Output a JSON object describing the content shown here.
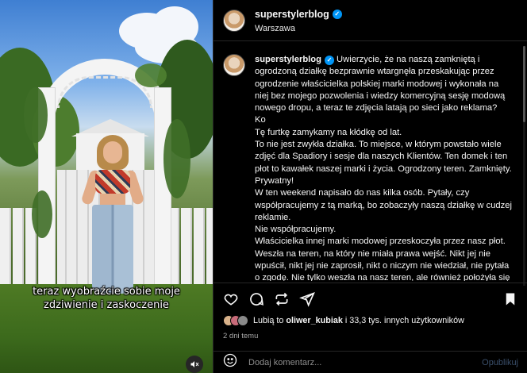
{
  "post": {
    "username": "superstylerblog",
    "location": "Warszawa",
    "caption_lines": [
      "Uwierzycie, że na naszą zamkniętą i",
      "ogrodzoną działkę bezprawnie wtargnęła przeskakując przez",
      "ogrodzenie właścicielka polskiej marki modowej i wykonała na",
      "niej bez mojego pozwolenia i wiedzy komercyjną sesję modową",
      "nowego dropu, a teraz te zdjęcia latają po sieci jako reklama?",
      "Ko",
      "Tę furtkę zamykamy na kłódkę od lat.",
      "To nie jest zwykła działka. To miejsce, w którym powstało wiele",
      "zdjęć dla Spadiory i sesje dla naszych Klientów. Ten domek i ten",
      "płot to kawałek naszej marki i życia. Ogrodzony teren. Zamknięty.",
      "Prywatny!",
      "W ten weekend napisało do nas kilka osób. Pytały, czy",
      "współpracujemy z tą marką, bo zobaczyły naszą działkę w cudzej",
      "reklamie.",
      "Nie współpracujemy.",
      "Właścicielka innej marki modowej przeskoczyła przez nasz płot.",
      "Weszła na teren, na który nie miała prawa wejść. Nikt jej nie",
      "wpuścił, nikt jej nie zaprosił, nikt o niczym nie wiedział, nie pytała",
      "o zgodę. Nie tylko weszła na nasz teren, ale również położyła się"
    ],
    "overlay_line1": "teraz wyobraźcie sobie moje",
    "overlay_line2": "zdziwienie i zaskoczenie",
    "likes_prefix": "Lubią to",
    "likes_user": "oliwer_kubiak",
    "likes_suffix": "i 33,3 tys. innych użytkowników",
    "time": "2 dni temu",
    "comment_placeholder": "Dodaj komentarz...",
    "publish_label": "Opublikuj"
  },
  "colors": {
    "background": "#000000",
    "verified": "#0095f6",
    "muted_text": "#a8a8a8",
    "publish_disabled": "#3a4f6b"
  },
  "icons": {
    "like": "heart-icon",
    "comment": "comment-icon",
    "share": "send-icon",
    "save": "bookmark-icon",
    "repost": "repost-icon",
    "emoji": "emoji-icon",
    "mute": "speaker-icon"
  }
}
